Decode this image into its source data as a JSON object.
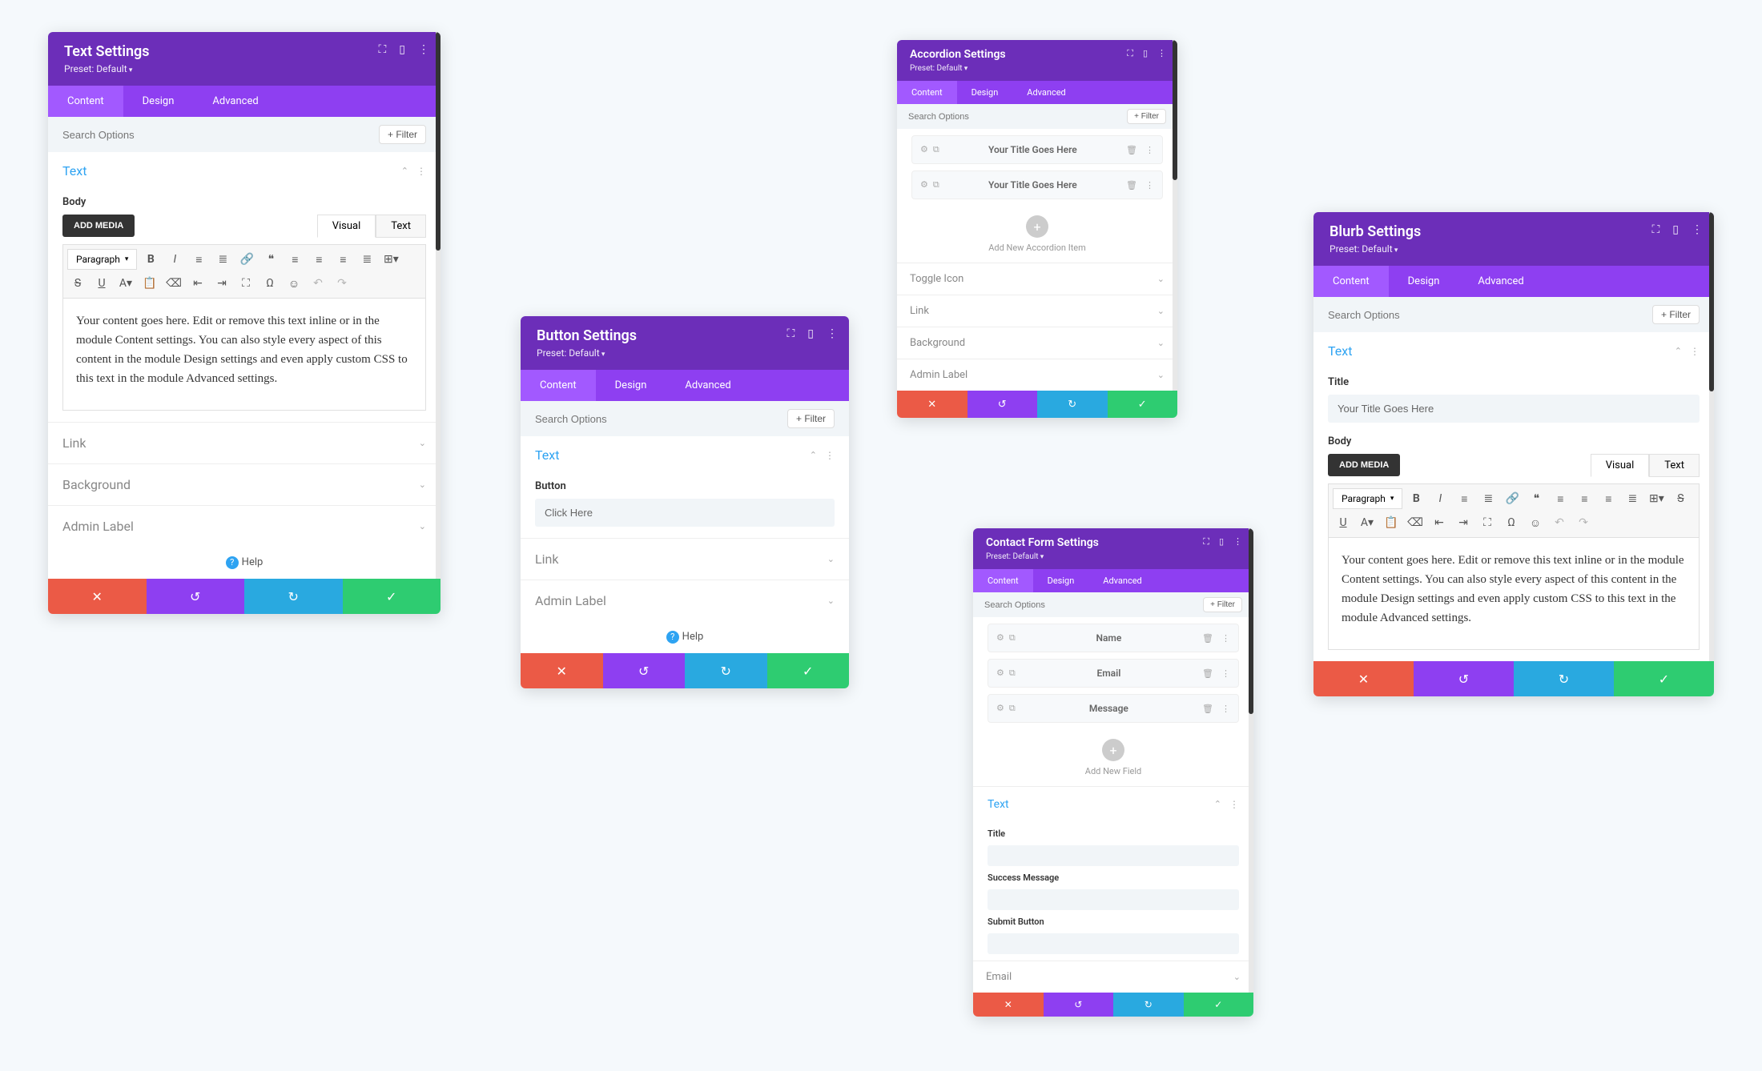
{
  "common": {
    "preset": "Preset: Default",
    "tabs": {
      "content": "Content",
      "design": "Design",
      "advanced": "Advanced"
    },
    "search_placeholder": "Search Options",
    "filter": "+  Filter",
    "help": "Help",
    "add_media": "ADD MEDIA",
    "editor_tabs": {
      "visual": "Visual",
      "text": "Text"
    },
    "paragraph": "Paragraph",
    "body_label": "Body",
    "text_section": "Text",
    "link_section": "Link",
    "background_section": "Background",
    "admin_label_section": "Admin Label",
    "body_content": "Your content goes here. Edit or remove this text inline or in the module Content settings. You can also style every aspect of this content in the module Design settings and even apply custom CSS to this text in the module Advanced settings."
  },
  "text_panel": {
    "title": "Text Settings"
  },
  "button_panel": {
    "title": "Button Settings",
    "button_label": "Button",
    "button_value": "Click Here"
  },
  "accordion_panel": {
    "title": "Accordion Settings",
    "items": [
      "Your Title Goes Here",
      "Your Title Goes Here"
    ],
    "add_new": "Add New Accordion Item",
    "sections": [
      "Toggle Icon",
      "Link",
      "Background",
      "Admin Label"
    ]
  },
  "contact_panel": {
    "title": "Contact Form Settings",
    "fields": [
      "Name",
      "Email",
      "Message"
    ],
    "add_new": "Add New Field",
    "title_label": "Title",
    "success_label": "Success Message",
    "submit_label": "Submit Button",
    "email_section": "Email"
  },
  "blurb_panel": {
    "title": "Blurb Settings",
    "title_label": "Title",
    "title_value": "Your Title Goes Here"
  }
}
